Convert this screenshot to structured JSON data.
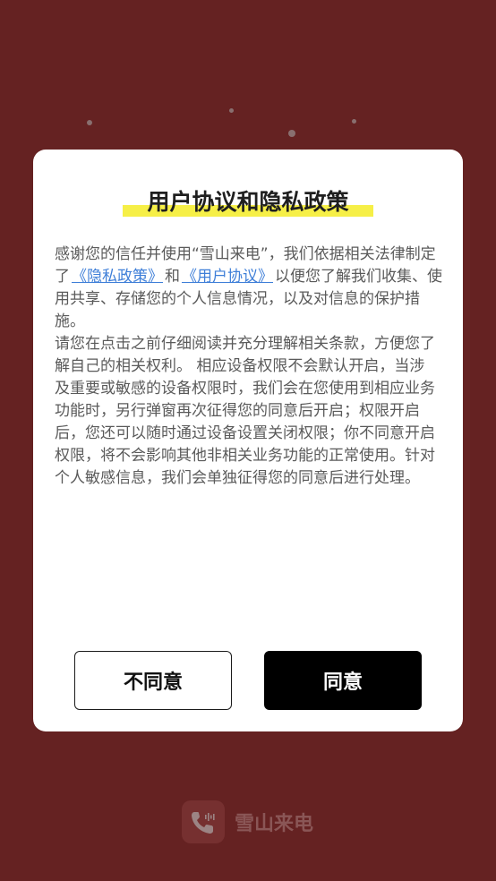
{
  "screen": {
    "background_color": "#652222"
  },
  "dialog": {
    "title": "用户协议和隐私政策",
    "highlight_color": "#f6ef47",
    "intro_line": "感谢您的信任并使用“雪山来电”，我们依据相关法律制定",
    "links_line": {
      "before": "了",
      "privacy_link": "《隐私政策》",
      "between": "和",
      "agreement_link": "《用户协议》",
      "after": "以便您了解我们收集、使"
    },
    "lines": [
      "用共享、存储您的个人信息情况，以及对信息的保护措",
      "施。",
      "请您在点击之前仔细阅读并充分理解相关条款，方便您了",
      "解自己的相关权利。 相应设备权限不会默认开启，当涉",
      "及重要或敏感的设备权限时，我们会在您使用到相应业务",
      "功能时，另行弹窗再次征得您的同意后开启；权限开启",
      "后，您还可以随时通过设备设置关闭权限；你不同意开启",
      "权限，将不会影响其他非相关业务功能的正常使用。针对",
      "个人敏感信息，我们会单独征得您的同意后进行处理。"
    ],
    "link_color": "#3f7fd8",
    "buttons": {
      "decline": "不同意",
      "accept": "同意"
    }
  },
  "app": {
    "name": "雪山来电",
    "icon": "phone-icon"
  }
}
